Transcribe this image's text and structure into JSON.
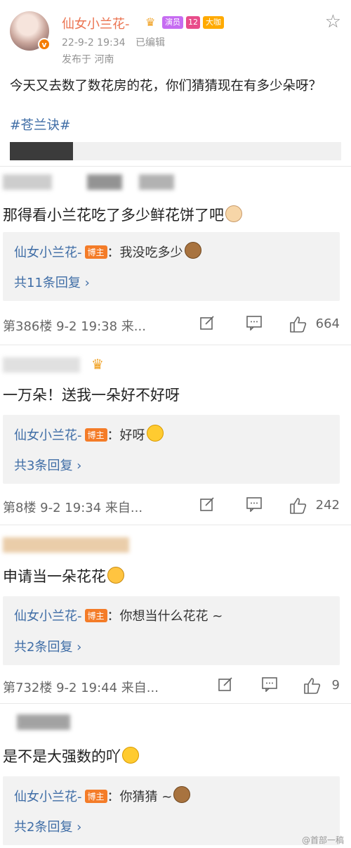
{
  "post": {
    "author": "仙女小兰花-",
    "verify_mark": "v",
    "badges": [
      "演员",
      "12",
      "大咖"
    ],
    "date": "22-9-2 19:34",
    "edited": "已编辑",
    "location": "发布于 河南",
    "text": "今天又去数了数花房的花，你们猜猜现在有多少朵呀？",
    "hashtag": "#苍兰诀#"
  },
  "comments": [
    {
      "text": "那得看小兰花吃了多少鲜花饼了吧",
      "emoji": "cat-emoji",
      "reply_author": "仙女小兰花-",
      "reply_tag": "博主",
      "reply_text": "：我没吃多少",
      "reply_emoji": "monkey-emoji",
      "reply_count": "共11条回复 ›",
      "floor": "第386楼 9-2 19:38 来...",
      "likes": "664"
    },
    {
      "text": "一万朵！送我一朵好不好呀",
      "emoji": "",
      "reply_author": "仙女小兰花-",
      "reply_tag": "博主",
      "reply_text": "：好呀",
      "reply_emoji": "laugh-emoji",
      "reply_count": "共3条回复 ›",
      "floor": "第8楼 9-2 19:34 来自...",
      "likes": "242"
    },
    {
      "text": "申请当一朵花花",
      "emoji": "tiger-emoji",
      "reply_author": "仙女小兰花-",
      "reply_tag": "博主",
      "reply_text": "：你想当什么花花 ~",
      "reply_emoji": "",
      "reply_count": "共2条回复 ›",
      "floor": "第732楼 9-2 19:44 来自...",
      "likes": "9"
    },
    {
      "text": "是不是大强数的吖",
      "emoji": "wow-emoji",
      "reply_author": "仙女小兰花-",
      "reply_tag": "博主",
      "reply_text": "：你猜猜 ~",
      "reply_emoji": "monkey-emoji",
      "reply_count": "共2条回复 ›",
      "floor": "",
      "likes": ""
    }
  ],
  "watermark": "@首部一稿"
}
